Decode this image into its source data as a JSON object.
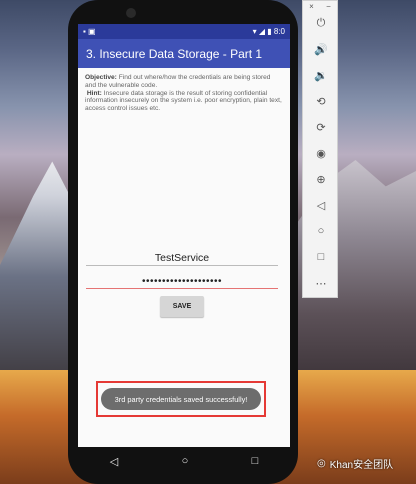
{
  "status_bar": {
    "time": "8:0"
  },
  "app_bar": {
    "title": "3. Insecure Data Storage - Part 1"
  },
  "description": {
    "objective_label": "Objective:",
    "objective_text": " Find out where/how the credentials are being stored and the vulnerable code.",
    "hint_label": "Hint:",
    "hint_text": " Insecure data storage is the result of storing confidential information insecurely on the system i.e. poor encryption, plain text, access control issues etc."
  },
  "form": {
    "service_value": "TestService",
    "password_value": "••••••••••••••••••••",
    "save_label": "SAVE"
  },
  "toast": {
    "message": "3rd party credentials saved successfully!"
  },
  "nav": {
    "back": "◁",
    "home": "○",
    "recents": "□"
  },
  "toolbar": {
    "close": "×",
    "minimize": "−"
  },
  "watermark": {
    "text": "Khan安全团队"
  }
}
